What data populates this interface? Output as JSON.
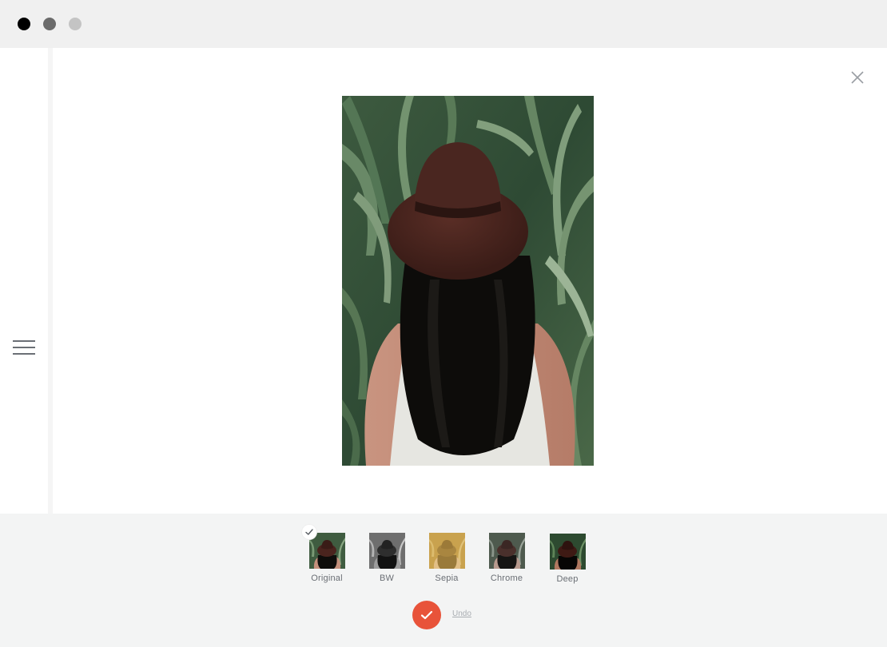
{
  "window": {
    "controls": [
      {
        "name": "close",
        "color": "#000000"
      },
      {
        "name": "minimize",
        "color": "#6b6b6b"
      },
      {
        "name": "zoom",
        "color": "#c4c4c4"
      }
    ]
  },
  "sidebar": {
    "menu_icon": "hamburger-menu-icon"
  },
  "viewer": {
    "close_icon": "close-icon",
    "image": "woman-in-hat-among-corn-leaves"
  },
  "filters": {
    "selected": "Original",
    "items": [
      {
        "label": "Original",
        "selected": true
      },
      {
        "label": "BW",
        "selected": false
      },
      {
        "label": "Sepia",
        "selected": false
      },
      {
        "label": "Chrome",
        "selected": false
      },
      {
        "label": "Deep",
        "selected": false
      }
    ]
  },
  "actions": {
    "apply_icon": "checkmark-icon",
    "undo_label": "Undo"
  },
  "colors": {
    "accent": "#e8533a",
    "background": "#f3f4f4"
  }
}
